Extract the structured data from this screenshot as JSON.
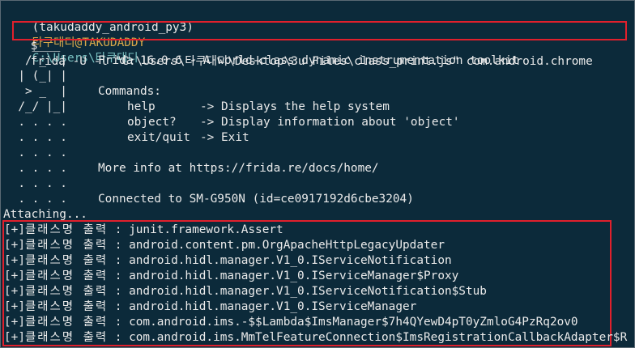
{
  "prompt": {
    "env": "(takudaddy_android_py3)",
    "host": "타쿠대디@TAKUDADDY",
    "path": "C:\\Users\\타쿠대디"
  },
  "command": {
    "dollar": "$",
    "text": "frida -U -l \"C:\\Users\\타쿠대디\\Desktop\\3u Files\\class_print.js\" com.android.chrome"
  },
  "banner": {
    "logo_lines": [
      "    ____",
      "   / _  |",
      "  | (_| |",
      "   > _  |",
      "  /_/ |_|",
      "  . . . .",
      "  . . . .",
      "  . . . .",
      "  . . . .",
      "  . . . .",
      "  . . . ."
    ],
    "title": "Frida 16.0.6 - A world-class dynamic instrumentation toolkit",
    "commands_heading": "Commands:",
    "commands": [
      {
        "name": "help",
        "desc": "-> Displays the help system"
      },
      {
        "name": "object?",
        "desc": "-> Display information about 'object'"
      },
      {
        "name": "exit/quit",
        "desc": "-> Exit"
      }
    ],
    "more_info": "More info at https://frida.re/docs/home/",
    "connected": "Connected to SM-G950N (id=ce0917192d6cbe3204)"
  },
  "attaching": "Attaching...",
  "output": {
    "prefix": "[+]",
    "label": "클래스명 출력",
    "separator": " : ",
    "rows": [
      "junit.framework.Assert",
      "android.content.pm.OrgApacheHttpLegacyUpdater",
      "android.hidl.manager.V1_0.IServiceNotification",
      "android.hidl.manager.V1_0.IServiceManager$Proxy",
      "android.hidl.manager.V1_0.IServiceNotification$Stub",
      "android.hidl.manager.V1_0.IServiceManager",
      "com.android.ims.-$$Lambda$ImsManager$7h4QYewD4pT0yZmloG4PzRq2ov0",
      "com.android.ims.MmTelFeatureConnection$ImsRegistrationCallbackAdapter$R"
    ]
  },
  "colors": {
    "background": "#0c2a3a",
    "text": "#eaeaea",
    "host": "#d5a84a",
    "path": "#78c0c0",
    "highlight_border": "#e0202c"
  }
}
